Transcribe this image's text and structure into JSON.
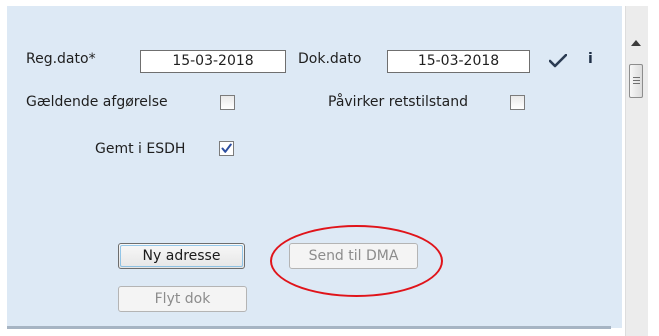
{
  "form": {
    "reg_dato_label": "Reg.dato*",
    "reg_dato_value": "15-03-2018",
    "dok_dato_label": "Dok.dato",
    "dok_dato_value": "15-03-2018",
    "info_label": "i",
    "gaeldende_label": "Gældende afgørelse",
    "gaeldende_checked": false,
    "paavirker_label": "Påvirker retstilstand",
    "paavirker_checked": false,
    "gemt_label": "Gemt i ESDH",
    "gemt_checked": true
  },
  "buttons": {
    "ny_adresse": "Ny adresse",
    "send_til_dma": "Send til DMA",
    "flyt_dok": "Flyt dok"
  },
  "colors": {
    "panel_bg": "#dde9f5",
    "annotation": "#e0141a",
    "check_mark": "#2d4fa0"
  }
}
